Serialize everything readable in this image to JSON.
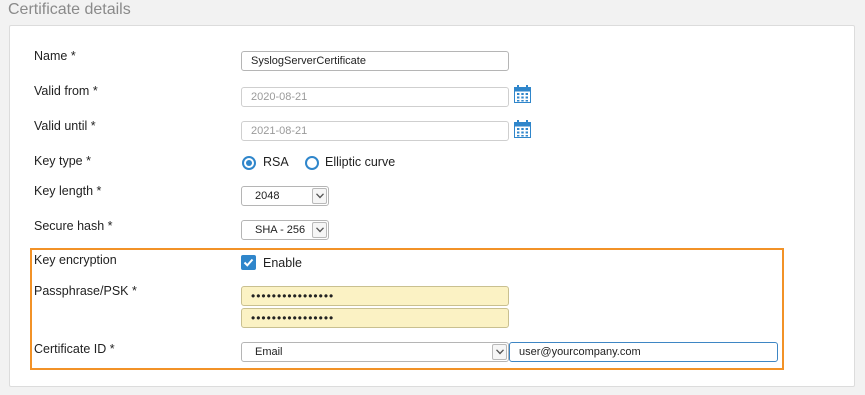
{
  "section": {
    "title": "Certificate details"
  },
  "fields": {
    "name": {
      "label": "Name *",
      "value": "SyslogServerCertificate"
    },
    "valid_from": {
      "label": "Valid from *",
      "value": "2020-08-21",
      "icon": "calendar-icon"
    },
    "valid_until": {
      "label": "Valid until *",
      "value": "2021-08-21",
      "icon": "calendar-icon"
    },
    "key_type": {
      "label": "Key type *",
      "options": [
        {
          "label": "RSA",
          "selected": true
        },
        {
          "label": "Elliptic curve",
          "selected": false
        }
      ]
    },
    "key_length": {
      "label": "Key length *",
      "value": "2048"
    },
    "secure_hash": {
      "label": "Secure hash *",
      "value": "SHA - 256"
    },
    "key_encryption": {
      "label": "Key encryption",
      "checkbox_label": "Enable",
      "checked": true
    },
    "passphrase": {
      "label": "Passphrase/PSK *",
      "value": "••••••••••••••••",
      "confirm_value": "••••••••••••••••"
    },
    "certificate_id": {
      "label": "Certificate ID *",
      "type_value": "Email",
      "value": "user@yourcompany.com"
    }
  },
  "colors": {
    "accent": "#2f86cb",
    "highlight_border": "#f29227",
    "password_fill": "#fbf2c4"
  }
}
